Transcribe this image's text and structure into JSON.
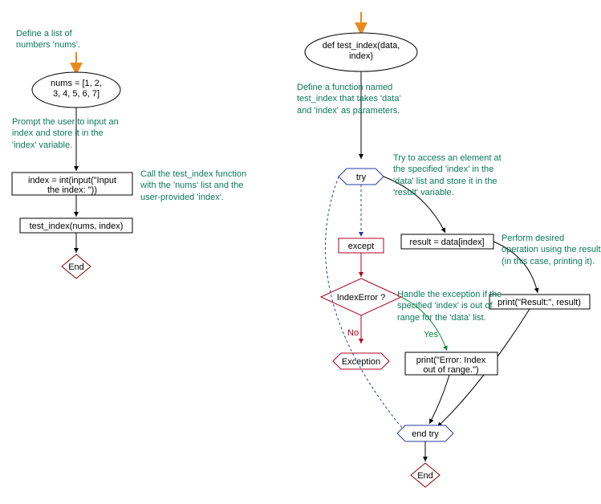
{
  "chart_data": {
    "type": "flowchart",
    "left_flow": {
      "annotations": {
        "define_list": "Define a list of numbers 'nums'.",
        "prompt_user": "Prompt the user to input an index and store it in the 'index' variable.",
        "call_func": "Call the test_index function with the 'nums' list and the user-provided 'index'."
      },
      "nodes": {
        "nums": "nums = [1, 2, 3, 4, 5, 6, 7]",
        "input_index": "index = int(input(\"Input the index: \"))",
        "test_call": "test_index(nums, index)",
        "end": "End"
      }
    },
    "right_flow": {
      "annotations": {
        "define_func": "Define a function named test_index that takes 'data' and 'index' as parameters.",
        "try_access": "Try to access an element at the specified 'index' in the 'data' list and store it in the 'result' variable.",
        "perform_op": "Perform desired operation using the result (in this case, printing it).",
        "handle_exc": "Handle the exception if the specified 'index' is out of range for the 'data' list."
      },
      "nodes": {
        "def_func": "def test_index(data, index)",
        "try": "try",
        "result_assign": "result = data[index]",
        "print_result": "print(\"Result:\", result)",
        "except": "except",
        "index_error": "IndexError ?",
        "exception": "Exception",
        "print_error": "print(\"Error: Index out of range.\")",
        "end_try": "end try",
        "end": "End"
      },
      "labels": {
        "yes": "Yes",
        "no": "No"
      }
    }
  }
}
